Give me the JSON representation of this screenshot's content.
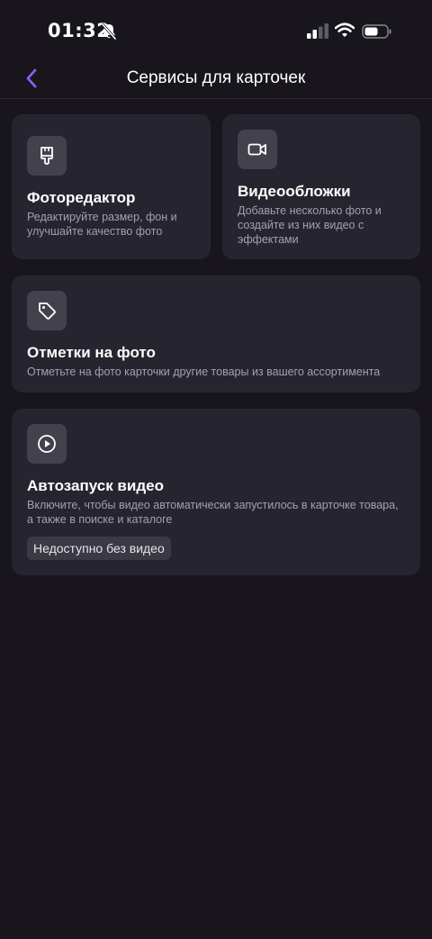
{
  "status_bar": {
    "time": "01:32"
  },
  "header": {
    "title": "Сервисы для карточек"
  },
  "cards": [
    {
      "title": "Фоторедактор",
      "description": "Редактируйте размер, фон и улучшайте качество фото",
      "icon": "brush-icon"
    },
    {
      "title": "Видеообложки",
      "description": "Добавьте несколько фото и создайте из них видео с эффектами",
      "icon": "video-camera-icon"
    },
    {
      "title": "Отметки на фото",
      "description": "Отметьте на фото карточки другие товары из вашего ассортимента",
      "icon": "tag-icon"
    },
    {
      "title": "Автозапуск видео",
      "description": "Включите, чтобы видео автоматически запустилось в карточке товара, а также в поиске и каталоге",
      "badge": "Недоступно без видео",
      "icon": "play-circle-icon"
    }
  ],
  "colors": {
    "accent": "#8e5cf0",
    "background": "#18161c",
    "card": "#26242e"
  }
}
